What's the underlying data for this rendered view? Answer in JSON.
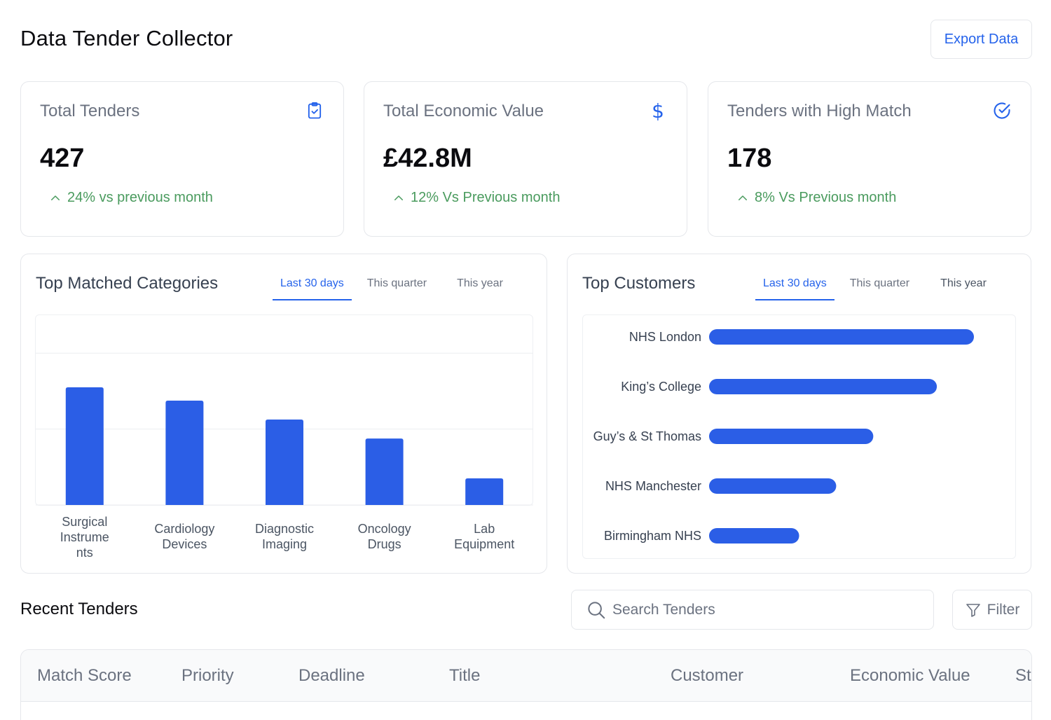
{
  "header": {
    "title": "Data Tender Collector",
    "export_label": "Export Data"
  },
  "stats": [
    {
      "label": "Total Tenders",
      "value": "427",
      "change": "24% vs previous month",
      "icon": "clipboard-check-icon"
    },
    {
      "label": "Total Economic Value",
      "value": "£42.8M",
      "change": "12% Vs Previous month",
      "icon": "dollar-icon",
      "icon_glyph": "$"
    },
    {
      "label": "Tenders with High Match",
      "value": "178",
      "change": "8% Vs Previous month",
      "icon": "check-circle-icon"
    }
  ],
  "categories_panel": {
    "title": "Top Matched Categories",
    "tabs": [
      "Last 30 days",
      "This quarter",
      "This year"
    ],
    "active_tab": 0
  },
  "customers_panel": {
    "title": "Top Customers",
    "tabs": [
      "Last 30 days",
      "This quarter",
      "This year"
    ],
    "active_tab": 0
  },
  "chart_data": [
    {
      "type": "bar",
      "orientation": "vertical",
      "categories": [
        [
          "Surgical",
          "Instrume",
          "nts"
        ],
        [
          "Cardiology",
          "Devices"
        ],
        [
          "Diagnostic",
          "Imaging"
        ],
        [
          "Oncology",
          "Drugs"
        ],
        [
          "Lab",
          "Equipment"
        ]
      ],
      "values": [
        62,
        55,
        45,
        35,
        14
      ],
      "ylim": [
        0,
        100
      ],
      "grid": true,
      "color": "#2b5ee6"
    },
    {
      "type": "bar",
      "orientation": "horizontal",
      "categories": [
        "NHS London",
        "King’s College",
        "Guy’s & St Thomas",
        "NHS Manchester",
        "Birmingham NHS"
      ],
      "values": [
        100,
        86,
        62,
        48,
        34
      ],
      "xlim": [
        0,
        100
      ],
      "grid": false,
      "color": "#2b5ee6"
    }
  ],
  "recent": {
    "title": "Recent Tenders",
    "search_placeholder": "Search Tenders",
    "filter_label": "Filter",
    "columns": [
      "Match Score",
      "Priority",
      "Deadline",
      "Title",
      "Customer",
      "Economic Value",
      "St"
    ]
  },
  "colors": {
    "accent": "#2563eb",
    "positive": "#4a9b5e",
    "muted": "#6b7280",
    "border": "#e5e7eb"
  }
}
